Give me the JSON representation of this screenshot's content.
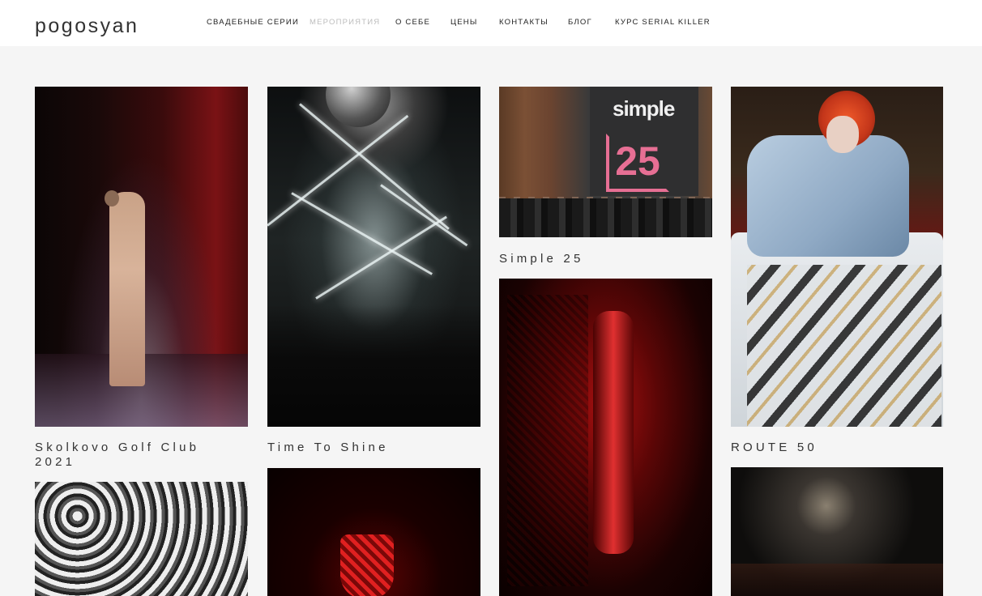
{
  "header": {
    "logo": "pogosyan",
    "nav": [
      {
        "label": "Свадебные серии",
        "active": false
      },
      {
        "label": "Мероприятия",
        "active": true
      },
      {
        "label": "О себе",
        "active": false
      },
      {
        "label": "Цены",
        "active": false
      },
      {
        "label": "Контакты",
        "active": false
      },
      {
        "label": "Блог",
        "active": false
      },
      {
        "label": "Курс SERIAL KILLER",
        "active": false
      }
    ]
  },
  "gallery": [
    {
      "title": "Skolkovo Golf Club\n2021"
    },
    {
      "title": "Time To Shine"
    },
    {
      "title": "Simple 25"
    },
    {
      "title": "ROUTE 50"
    }
  ],
  "photo_text": {
    "simple_brand": "simple",
    "simple_number": "25"
  },
  "colors": {
    "background": "#f5f5f5",
    "header_bg": "#ffffff",
    "nav_active": "#bdbdbd",
    "text": "#333333"
  }
}
